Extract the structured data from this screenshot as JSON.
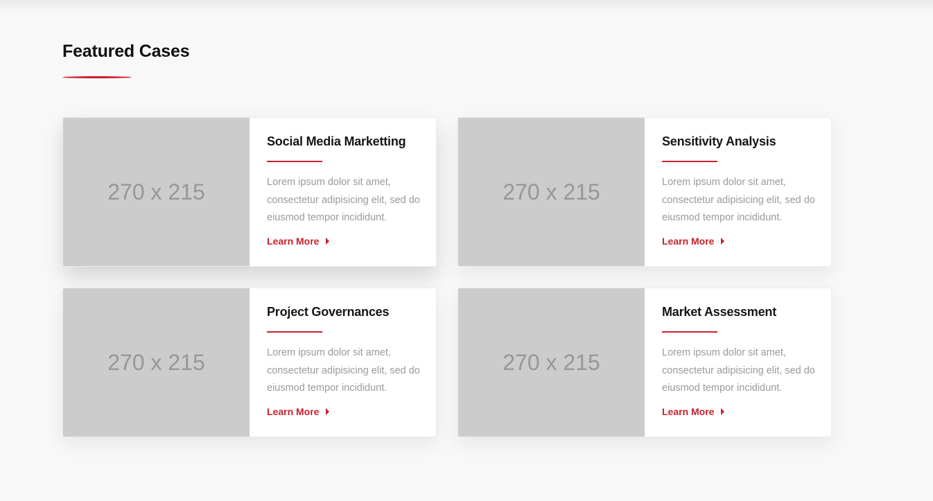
{
  "section": {
    "title": "Featured Cases",
    "accent_color": "#c9202b"
  },
  "cards": [
    {
      "image_label": "270 x 215",
      "title": "Social Media Marketting",
      "text": "Lorem ipsum dolor sit amet, consectetur adipisicing elit, sed do eiusmod tempor incididunt.",
      "link_label": "Learn More"
    },
    {
      "image_label": "270 x 215",
      "title": "Sensitivity Analysis",
      "text": "Lorem ipsum dolor sit amet, consectetur adipisicing elit, sed do eiusmod tempor incididunt.",
      "link_label": "Learn More"
    },
    {
      "image_label": "270 x 215",
      "title": "Project Governances",
      "text": "Lorem ipsum dolor sit amet, consectetur adipisicing elit, sed do eiusmod tempor incididunt.",
      "link_label": "Learn More"
    },
    {
      "image_label": "270 x 215",
      "title": "Market Assessment",
      "text": "Lorem ipsum dolor sit amet, consectetur adipisicing elit, sed do eiusmod tempor incididunt.",
      "link_label": "Learn More"
    }
  ]
}
